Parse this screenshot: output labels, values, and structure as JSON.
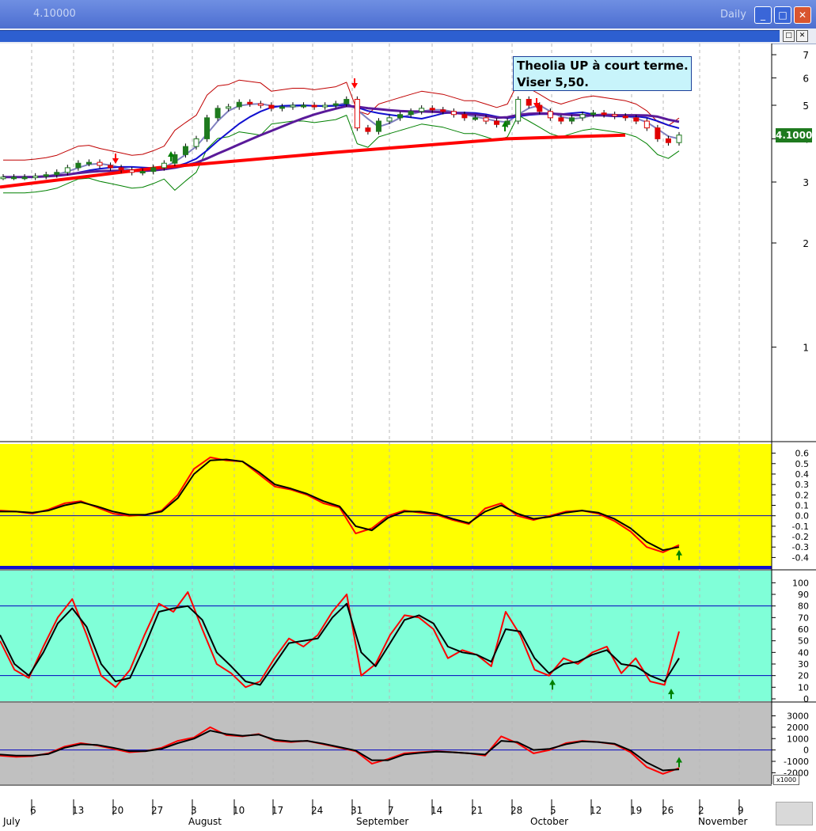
{
  "window": {
    "title": "4.10000",
    "period": "Daily",
    "minimize_glyph": "_",
    "maximize_glyph": "□",
    "close_glyph": "✕"
  },
  "subwindow": {
    "restore_glyph": "□",
    "close_glyph": "✕"
  },
  "annotation": {
    "line1": "Theolia UP à court terme.",
    "line2": "Viser 5,50."
  },
  "price_badge": "4.1000",
  "volume_scale_label": "x1000",
  "colors": {
    "price_bg": "#ffffff",
    "macd_bg": "#ffff00",
    "stoch_bg": "#80ffd8",
    "vol_bg": "#c0c0c0",
    "sma_long": "#ff0000",
    "ema_mid": "#5a1a9a",
    "ema_short": "#1010d0",
    "bollinger_outer": "#c00000",
    "bollinger_inner": "#008000",
    "signal_line": "#000000",
    "fast_line": "#ff0000",
    "up_arrow": "#008000",
    "down_arrow": "#ff0000",
    "badge_bg": "#1e7a1e"
  },
  "chart_data": [
    {
      "type": "candlestick",
      "title": "",
      "scale": "log",
      "y_ticks": [
        7,
        6,
        5,
        4,
        3,
        2,
        1
      ],
      "x_date_labels": [
        "6",
        "13",
        "20",
        "27",
        "3",
        "10",
        "17",
        "24",
        "31",
        "7",
        "14",
        "21",
        "28",
        "5",
        "12",
        "19",
        "26",
        "2",
        "9"
      ],
      "month_labels": [
        "July",
        "August",
        "September",
        "October",
        "November"
      ],
      "close_series": [
        3.1,
        3.1,
        3.1,
        3.12,
        3.15,
        3.2,
        3.3,
        3.4,
        3.42,
        3.35,
        3.3,
        3.25,
        3.2,
        3.22,
        3.3,
        3.4,
        3.6,
        3.8,
        4.0,
        4.6,
        4.9,
        4.95,
        5.1,
        5.05,
        5.0,
        4.9,
        4.95,
        5.0,
        5.0,
        4.95,
        5.0,
        5.05,
        5.2,
        4.3,
        4.2,
        4.5,
        4.6,
        4.7,
        4.8,
        4.9,
        4.85,
        4.8,
        4.7,
        4.6,
        4.6,
        4.5,
        4.4,
        4.5,
        5.2,
        5.0,
        4.8,
        4.6,
        4.5,
        4.6,
        4.7,
        4.75,
        4.7,
        4.65,
        4.6,
        4.5,
        4.3,
        4.0,
        3.9,
        4.1
      ],
      "sma_long_approx": [
        2.9,
        3.3,
        3.65,
        4.0,
        4.1
      ],
      "buy_signals": [
        "Aug 1",
        "Sep 28",
        "Oct 29"
      ],
      "sell_signals": [
        "Jul 21",
        "Aug 31",
        "Oct 3"
      ]
    },
    {
      "type": "line",
      "title": "",
      "ylim": [
        -0.45,
        0.65
      ],
      "y_ticks": [
        0.6,
        0.5,
        0.4,
        0.3,
        0.2,
        0.1,
        0.0,
        -0.1,
        -0.2,
        -0.3,
        -0.4
      ],
      "series": [
        {
          "values": [
            0.05,
            0.04,
            0.02,
            0.06,
            0.12,
            0.14,
            0.08,
            0.02,
            0.0,
            0.01,
            0.05,
            0.2,
            0.45,
            0.56,
            0.53,
            0.52,
            0.4,
            0.28,
            0.25,
            0.2,
            0.12,
            0.08,
            -0.17,
            -0.12,
            0.0,
            0.05,
            0.03,
            0.01,
            -0.04,
            -0.08,
            0.07,
            0.12,
            0.0,
            -0.04,
            0.0,
            0.04,
            0.05,
            0.02,
            -0.05,
            -0.15,
            -0.3,
            -0.35,
            -0.28
          ]
        },
        {
          "values": [
            0.04,
            0.04,
            0.03,
            0.05,
            0.1,
            0.13,
            0.09,
            0.04,
            0.01,
            0.01,
            0.04,
            0.17,
            0.4,
            0.53,
            0.54,
            0.52,
            0.42,
            0.3,
            0.26,
            0.21,
            0.14,
            0.09,
            -0.1,
            -0.14,
            -0.02,
            0.04,
            0.04,
            0.02,
            -0.03,
            -0.07,
            0.04,
            0.1,
            0.02,
            -0.03,
            -0.01,
            0.03,
            0.05,
            0.03,
            -0.03,
            -0.12,
            -0.25,
            -0.33,
            -0.3
          ]
        }
      ]
    },
    {
      "type": "line",
      "title": "",
      "ylim": [
        0,
        105
      ],
      "y_ticks": [
        100,
        90,
        80,
        70,
        60,
        50,
        40,
        30,
        20,
        10,
        0
      ],
      "reference_lines": [
        80,
        20
      ],
      "series": [
        {
          "values": [
            50,
            25,
            18,
            45,
            70,
            86,
            55,
            20,
            10,
            25,
            55,
            82,
            75,
            92,
            60,
            30,
            22,
            10,
            15,
            35,
            52,
            45,
            55,
            75,
            90,
            20,
            30,
            55,
            72,
            70,
            60,
            35,
            42,
            38,
            28,
            75,
            55,
            25,
            20,
            35,
            30,
            40,
            45,
            22,
            35,
            15,
            12,
            58
          ]
        },
        {
          "values": [
            55,
            30,
            20,
            40,
            65,
            78,
            62,
            30,
            15,
            18,
            45,
            75,
            78,
            80,
            68,
            40,
            28,
            15,
            12,
            30,
            48,
            50,
            52,
            70,
            82,
            40,
            28,
            48,
            68,
            72,
            65,
            45,
            40,
            38,
            32,
            60,
            58,
            35,
            22,
            30,
            32,
            38,
            42,
            30,
            28,
            20,
            15,
            35
          ]
        }
      ]
    },
    {
      "type": "line",
      "title": "",
      "y_ticks": [
        3000,
        2000,
        1000,
        0,
        -1000,
        -2000
      ],
      "series": [
        {
          "values": [
            -500,
            -600,
            -550,
            -300,
            300,
            600,
            400,
            100,
            -200,
            -100,
            200,
            800,
            1100,
            2000,
            1300,
            1200,
            1400,
            800,
            700,
            800,
            500,
            200,
            -100,
            -1200,
            -800,
            -300,
            -200,
            -100,
            -200,
            -300,
            -500,
            1200,
            600,
            -300,
            0,
            600,
            800,
            700,
            500,
            -200,
            -1500,
            -2100,
            -1600
          ]
        },
        {
          "values": [
            -400,
            -500,
            -500,
            -350,
            200,
            500,
            450,
            200,
            -100,
            -100,
            100,
            600,
            1000,
            1700,
            1400,
            1250,
            1350,
            900,
            750,
            800,
            550,
            250,
            -50,
            -900,
            -900,
            -400,
            -250,
            -150,
            -200,
            -300,
            -400,
            800,
            700,
            0,
            100,
            500,
            750,
            700,
            550,
            -50,
            -1100,
            -1800,
            -1700
          ]
        }
      ]
    }
  ]
}
